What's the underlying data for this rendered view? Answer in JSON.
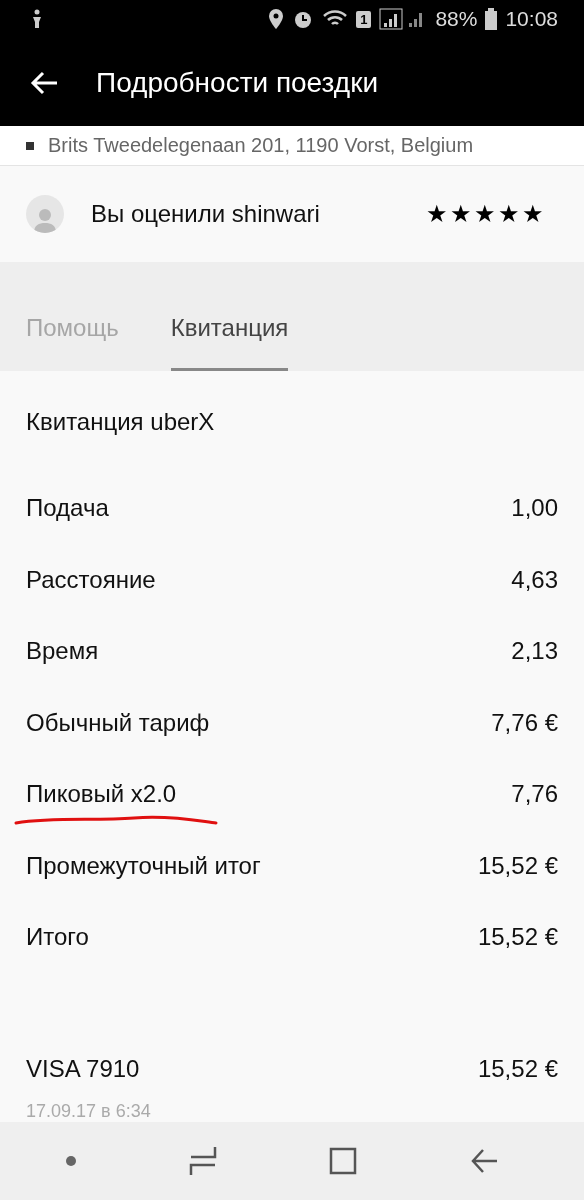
{
  "status_bar": {
    "battery": "88%",
    "time": "10:08",
    "sim": "1"
  },
  "header": {
    "title": "Подробности поездки"
  },
  "address": "Brits Tweedelegenaan 201, 1190 Vorst, Belgium",
  "rating": {
    "text": "Вы оценили shinwari",
    "stars": 5
  },
  "tabs": [
    {
      "label": "Помощь",
      "selected": false
    },
    {
      "label": "Квитанция",
      "selected": true
    }
  ],
  "receipt": {
    "title": "Квитанция uberX",
    "rows": [
      {
        "label": "Подача",
        "value": "1,00",
        "underlined": false
      },
      {
        "label": "Расстояние",
        "value": "4,63",
        "underlined": false
      },
      {
        "label": "Время",
        "value": "2,13",
        "underlined": false
      },
      {
        "label": "Обычный тариф",
        "value": "7,76 €",
        "underlined": false
      },
      {
        "label": "Пиковый x2.0",
        "value": "7,76",
        "underlined": true
      },
      {
        "label": "Промежуточный итог",
        "value": "15,52 €",
        "underlined": false
      },
      {
        "label": "Итого",
        "value": "15,52 €",
        "underlined": false
      }
    ],
    "payment": {
      "card": "VISA 7910",
      "amount": "15,52 €",
      "date": "17.09.17 в 6:34"
    }
  }
}
